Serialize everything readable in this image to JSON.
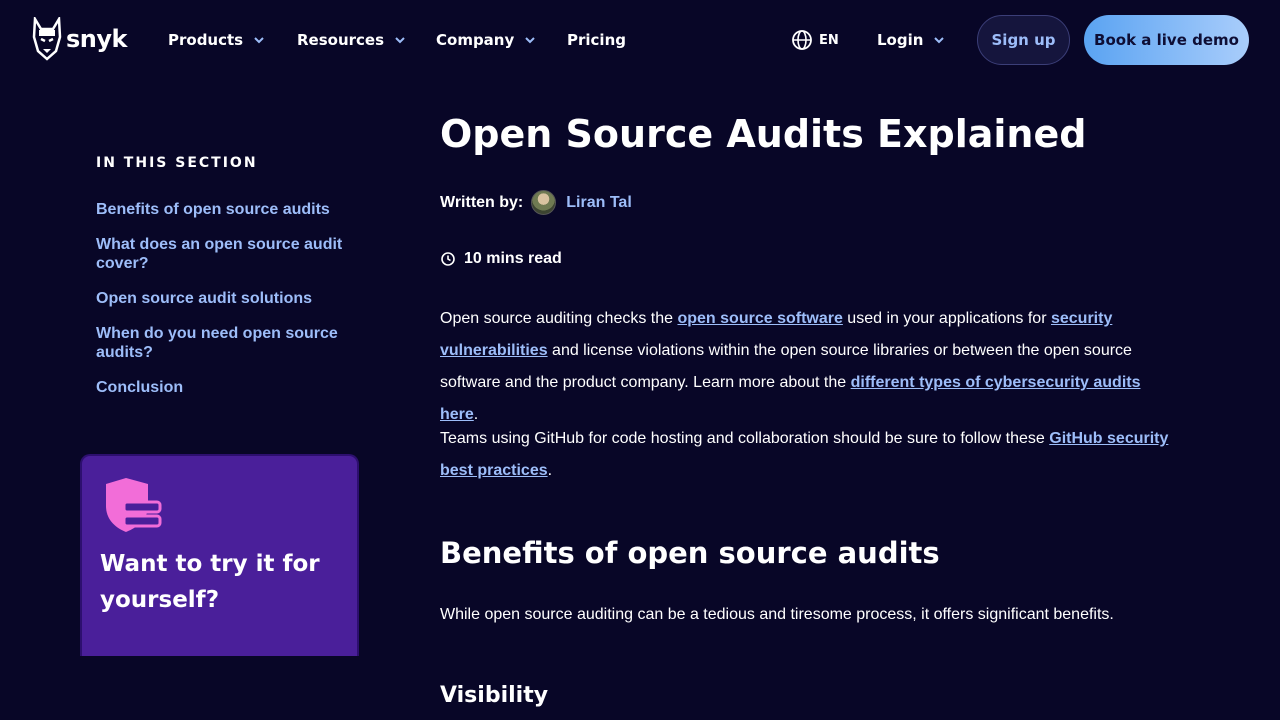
{
  "header": {
    "logo_text": "snyk",
    "nav": [
      {
        "label": "Products",
        "has_dropdown": true
      },
      {
        "label": "Resources",
        "has_dropdown": true
      },
      {
        "label": "Company",
        "has_dropdown": true
      },
      {
        "label": "Pricing",
        "has_dropdown": false
      }
    ],
    "language": "EN",
    "login_label": "Login",
    "signup_label": "Sign up",
    "demo_label": "Book a live demo"
  },
  "sidebar": {
    "section_title": "IN THIS SECTION",
    "items": [
      {
        "label": "Benefits of open source audits"
      },
      {
        "label": "What does an open source audit cover?"
      },
      {
        "label": "Open source audit solutions"
      },
      {
        "label": "When do you need open source audits?"
      },
      {
        "label": "Conclusion"
      }
    ],
    "card_title": "Want to try it for yourself?"
  },
  "article": {
    "title": "Open Source Audits Explained",
    "written_by_label": "Written by:",
    "author": "Liran Tal",
    "read_time": "10 mins read",
    "p1": {
      "t1": "Open source auditing checks the ",
      "l1": "open source software",
      "t2": " used in your applications for ",
      "l2": "security vulnerabilities",
      "t3": " and license violations within the open source libraries or between the open source software and the product company. Learn more about the ",
      "l3": "different types of cybersecurity audits here",
      "t4": "."
    },
    "p2": {
      "t1": "Teams using GitHub for code hosting and collaboration should be sure to follow these ",
      "l1": "GitHub security best practices",
      "t2": "."
    },
    "h2": "Benefits of open source audits",
    "p3": "While open source auditing can be a tedious and tiresome process, it offers significant benefits.",
    "h3": "Visibility"
  },
  "colors": {
    "background": "#080627",
    "link": "#9dbdf9",
    "card": "#4a1f9a",
    "demo_gradient_start": "#5aa3f2",
    "demo_gradient_end": "#a9cdfb"
  }
}
